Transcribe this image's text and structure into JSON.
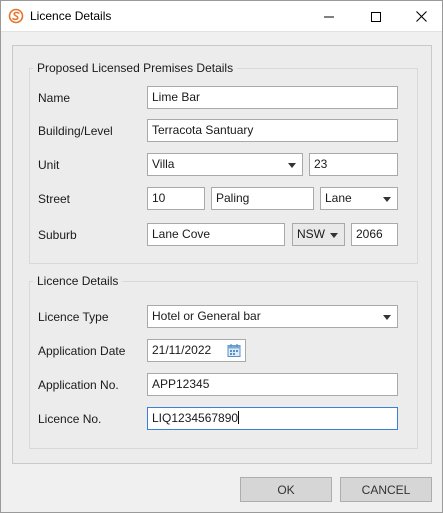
{
  "window": {
    "title": "Licence Details"
  },
  "premises": {
    "group_title": "Proposed Licensed Premises Details",
    "name": {
      "label": "Name",
      "value": "Lime Bar"
    },
    "building": {
      "label": "Building/Level",
      "value": "Terracota Santuary"
    },
    "unit": {
      "label": "Unit",
      "type_value": "Villa",
      "number_value": "23"
    },
    "street": {
      "label": "Street",
      "number_value": "10",
      "name_value": "Paling",
      "type_value": "Lane"
    },
    "suburb": {
      "label": "Suburb",
      "value": "Lane Cove",
      "state_value": "NSW",
      "postcode_value": "2066"
    }
  },
  "licence": {
    "group_title": "Licence Details",
    "type": {
      "label": "Licence Type",
      "value": "Hotel or General bar"
    },
    "application_date": {
      "label": "Application Date",
      "value": "21/11/2022"
    },
    "application_no": {
      "label": "Application No.",
      "value": "APP12345"
    },
    "licence_no": {
      "label": "Licence No.",
      "value": "LIQ1234567890"
    }
  },
  "buttons": {
    "ok": "OK",
    "cancel": "CANCEL"
  },
  "colors": {
    "focus_border": "#3c7fd6",
    "app_icon": "#e8742a"
  }
}
